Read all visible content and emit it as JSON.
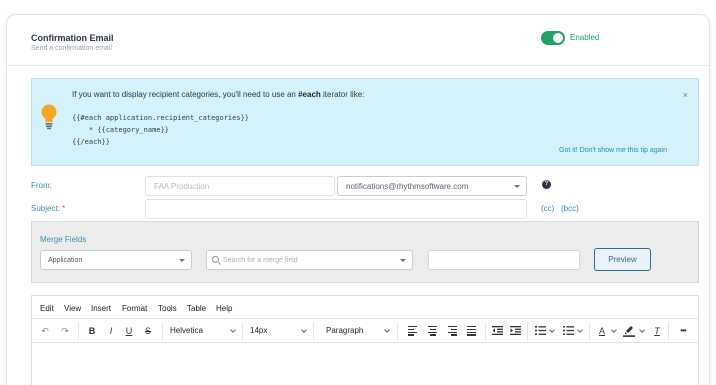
{
  "header": {
    "title": "Confirmation Email",
    "subtitle": "Send a confirmation email",
    "toggle_label": "Enabled"
  },
  "tip": {
    "text_before": "If you want to display recipient categories, you'll need to use an ",
    "text_bold": "#each",
    "text_after": " iterator like:",
    "code_line1": "{{#each application.recipient_categories}}",
    "code_line2": "    * {{category_name}}",
    "code_line3": "{{/each}}",
    "close": "×",
    "dismiss": "Got it! Don't show me this tip again"
  },
  "form": {
    "from_label": "From:",
    "from_name_placeholder": "FAA Production",
    "from_email_value": "notifications@rhythmsoftware.com",
    "help": "?",
    "subject_label": "Subject:",
    "subject_required": "*",
    "subject_value": "",
    "cc": "(cc)",
    "bcc": "(bcc)"
  },
  "merge": {
    "title": "Merge Fields",
    "source_value": "Application",
    "search_placeholder": "Search for a merge field",
    "preview_button": "Preview"
  },
  "editor": {
    "menu": [
      "Edit",
      "View",
      "Insert",
      "Format",
      "Tools",
      "Table",
      "Help"
    ],
    "font_family": "Helvetica",
    "font_size": "14px",
    "block_format": "Paragraph",
    "undo": "↶",
    "redo": "↷",
    "bold": "B",
    "italic": "I",
    "underline": "U",
    "strike": "S",
    "text_color": "A",
    "clear_format": "T",
    "more": "•••"
  },
  "colors": {
    "accent": "#21a366",
    "link": "#2a8fae",
    "tip_bg": "#d4f2f8",
    "bulb": "#f5a623"
  }
}
